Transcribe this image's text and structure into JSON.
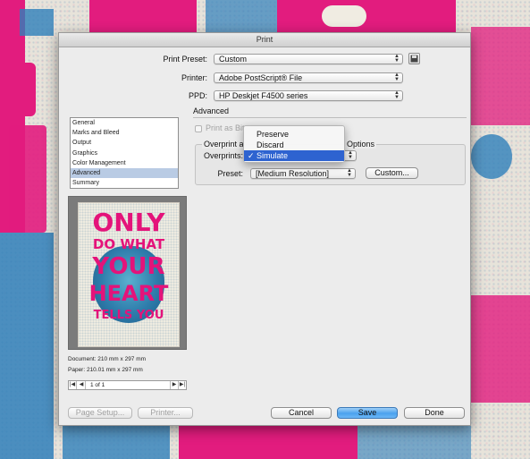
{
  "window": {
    "title": "Print"
  },
  "header": {
    "print_preset": {
      "label": "Print Preset:",
      "value": "Custom"
    },
    "printer": {
      "label": "Printer:",
      "value": "Adobe PostScript® File"
    },
    "ppd": {
      "label": "PPD:",
      "value": "HP Deskjet F4500 series"
    }
  },
  "sidebar": {
    "items": [
      "General",
      "Marks and Bleed",
      "Output",
      "Graphics",
      "Color Management",
      "Advanced",
      "Summary"
    ],
    "selected": "Advanced"
  },
  "preview": {
    "poster_lines": [
      "ONLY",
      "DO WHAT",
      "YOUR",
      "HEART",
      "TELLS YOU"
    ],
    "document": "Document: 210 mm x 297 mm",
    "paper": "Paper: 210.01 mm x 297 mm",
    "page_indicator": "1 of 1"
  },
  "advanced": {
    "title": "Advanced",
    "print_as_bitmap": "Print as Bit",
    "overprint_group_title_left": "Overprint a",
    "overprint_group_title_right": "Options",
    "overprints_label": "Overprints:",
    "overprints_options": [
      "Preserve",
      "Discard",
      "Simulate"
    ],
    "overprints_selected": "Simulate",
    "preset_label": "Preset:",
    "preset_value": "[Medium Resolution]",
    "custom_button": "Custom..."
  },
  "footer": {
    "page_setup": "Page Setup...",
    "printer": "Printer...",
    "cancel": "Cancel",
    "save": "Save",
    "done": "Done"
  },
  "colors": {
    "accent_blue": "#4aa1ee",
    "menu_highlight": "#2e63d0",
    "pink": "#e21c7e",
    "blue": "#2f7fba"
  }
}
